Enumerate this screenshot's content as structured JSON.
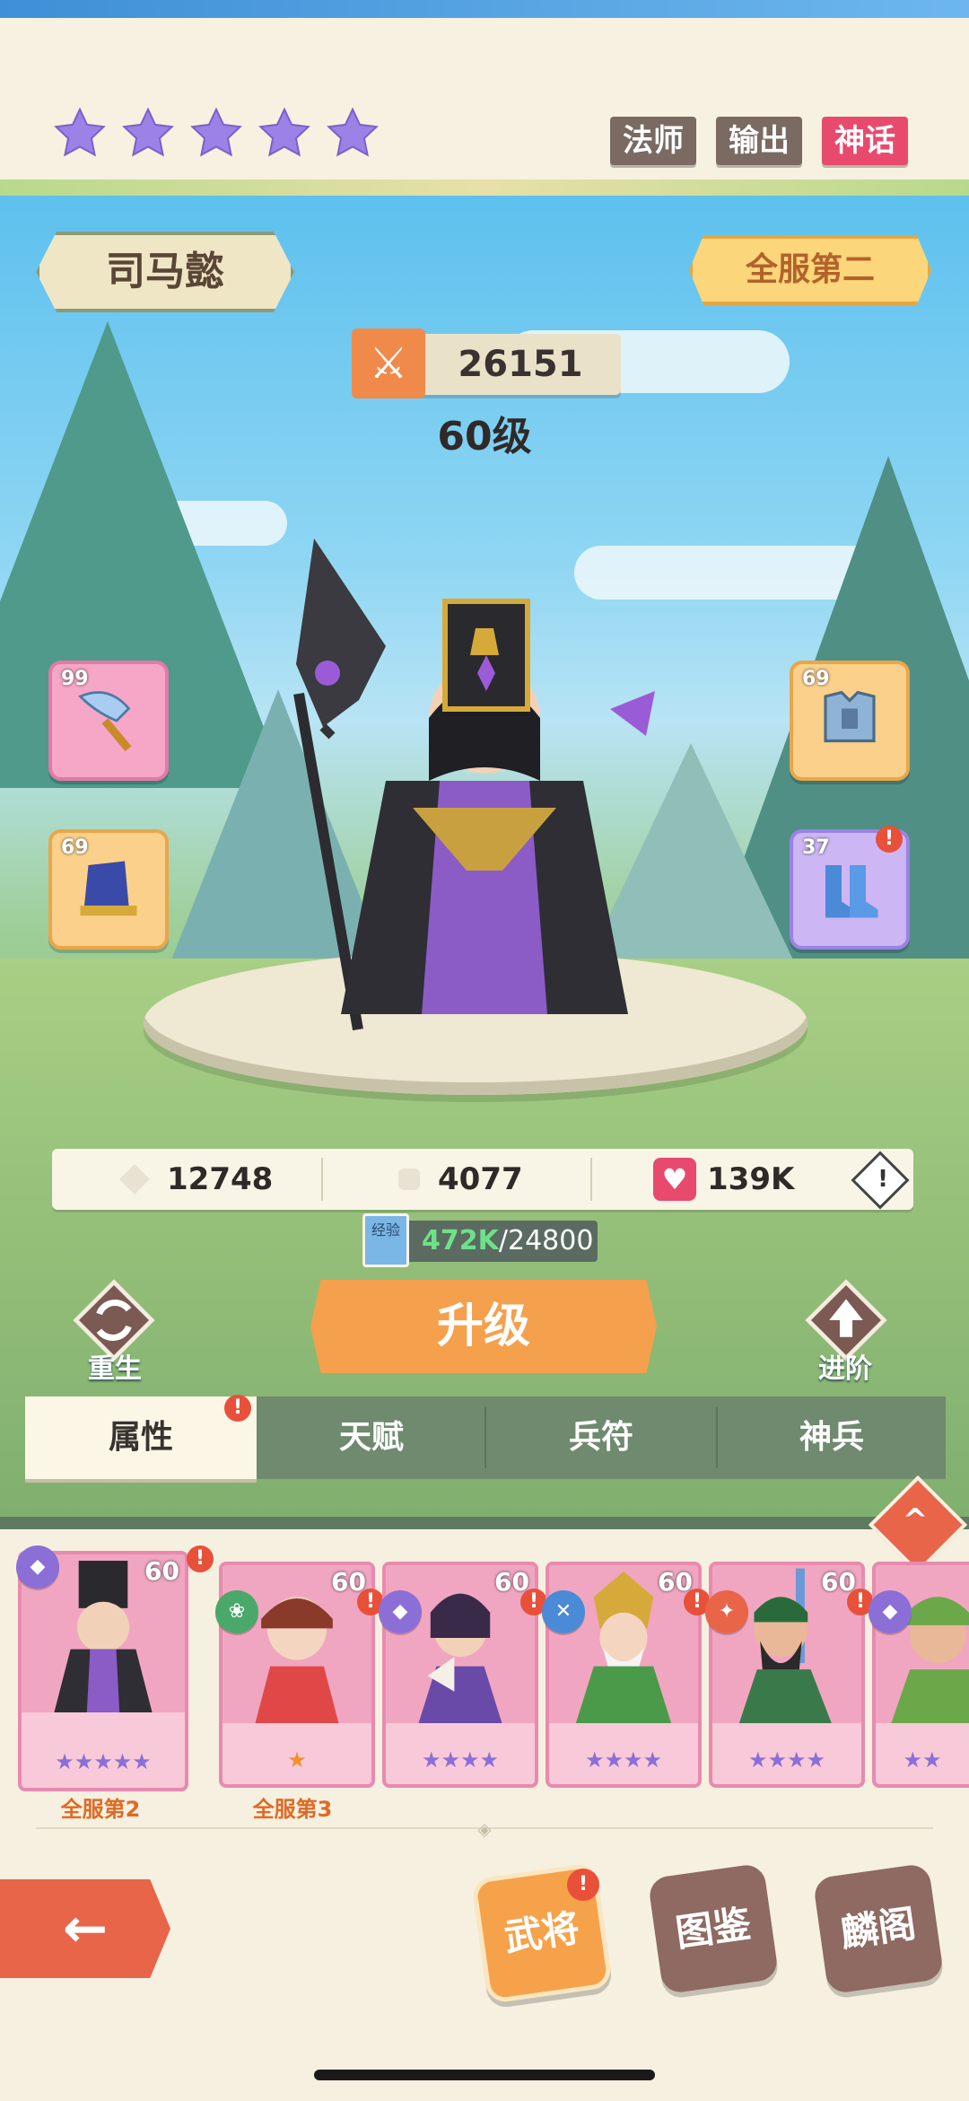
{
  "hero": {
    "name": "司马懿",
    "rank_badge": "全服第二",
    "power": "26151",
    "level": "60级",
    "star_count": 5,
    "tags": [
      "法师",
      "输出",
      "神话"
    ]
  },
  "equipment": [
    {
      "slot": "weapon",
      "level": "99",
      "icon": "fan-weapon-icon"
    },
    {
      "slot": "helmet",
      "level": "69",
      "icon": "hat-icon"
    },
    {
      "slot": "armor",
      "level": "69",
      "icon": "armor-icon"
    },
    {
      "slot": "boots",
      "level": "37",
      "icon": "boots-icon",
      "alert": "!"
    }
  ],
  "stats": {
    "attack": "12748",
    "defense": "4077",
    "hp": "139K",
    "info_icon": "!"
  },
  "exp": {
    "label_icon": "经验",
    "current": "472K",
    "required": "/24800"
  },
  "actions": {
    "rebirth": "重生",
    "upgrade": "升级",
    "advance": "进阶"
  },
  "tabs": [
    {
      "label": "属性",
      "active": true,
      "alert": "!"
    },
    {
      "label": "天赋"
    },
    {
      "label": "兵符"
    },
    {
      "label": "神兵"
    }
  ],
  "roster": [
    {
      "level": "60",
      "stars": "★★★★★",
      "rank": "全服第2",
      "alert": "!"
    },
    {
      "level": "60",
      "stars": "★",
      "rank": "全服第3",
      "alert": "!"
    },
    {
      "level": "60",
      "stars": "★★★★",
      "rank": "",
      "alert": "!"
    },
    {
      "level": "60",
      "stars": "★★★★",
      "rank": "",
      "alert": "!"
    },
    {
      "level": "60",
      "stars": "★★★★",
      "rank": "",
      "alert": "!"
    },
    {
      "level": "",
      "stars": "★★",
      "rank": ""
    }
  ],
  "nav": {
    "back": "←",
    "heroes": "武将",
    "heroes_alert": "!",
    "codex": "图鉴",
    "pavilion": "麟阁"
  },
  "colors": {
    "accent_orange": "#f4a04c",
    "star_purple": "#9b82e6",
    "tag_red": "#e8503a",
    "card_pink": "#f8c9d8"
  }
}
